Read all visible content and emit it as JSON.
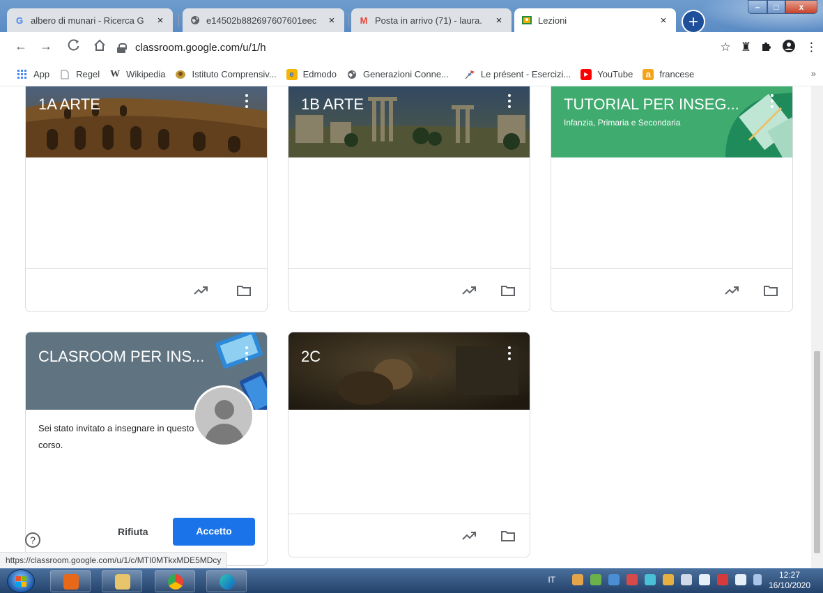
{
  "browser": {
    "tabs": [
      {
        "title": "albero di munari - Ricerca G",
        "icon": "google-g-icon",
        "icon_text": "G",
        "icon_color": "#4285f4"
      },
      {
        "title": "e14502b882697607601eec",
        "icon": "globe-icon",
        "icon_text": "",
        "icon_color": "#5f6368"
      },
      {
        "title": "Posta in arrivo (71) - laura.",
        "icon": "gmail-icon",
        "icon_text": "M",
        "icon_color": "#ea4335"
      },
      {
        "title": "Lezioni",
        "icon": "classroom-icon",
        "icon_text": "",
        "icon_color": "#f9ab00"
      }
    ],
    "new_tab_label": "+",
    "close_label": "×",
    "url": "classroom.google.com/u/1/h",
    "window_controls": {
      "min": "–",
      "max": "□",
      "close": "x"
    }
  },
  "bookmarks": [
    {
      "label": "App",
      "icon": "apps-grid-icon",
      "icon_text": "⁝⁝⁝",
      "color": "#4285f4"
    },
    {
      "label": "Regel",
      "icon": "page-icon",
      "icon_text": "",
      "color": "#9aa0a6"
    },
    {
      "label": "Wikipedia",
      "icon": "wikipedia-icon",
      "icon_text": "W",
      "color": "#000000"
    },
    {
      "label": "Istituto Comprensiv...",
      "icon": "school-crest-icon",
      "icon_text": "",
      "color": "#c49a3a"
    },
    {
      "label": "Edmodo",
      "icon": "edmodo-icon",
      "icon_text": "e",
      "color": "#f4b400"
    },
    {
      "label": "Generazioni Conne...",
      "icon": "globe-icon",
      "icon_text": "",
      "color": "#5f6368"
    },
    {
      "label": "Le présent - Esercizi...",
      "icon": "flag-fr-icon",
      "icon_text": "",
      "color": "#3a6fd8"
    },
    {
      "label": "YouTube",
      "icon": "youtube-icon",
      "icon_text": "▶",
      "color": "#ff0000"
    },
    {
      "label": "francese",
      "icon": "folder-a-icon",
      "icon_text": "a",
      "color": "#f4a31c"
    }
  ],
  "bookmarks_more": "»",
  "colors": {
    "card_green": "#3fab6f",
    "card_slate": "#5f7380",
    "accent_blue": "#1a73e8"
  },
  "cards": [
    {
      "title": "1A ARTE",
      "subtitle": ""
    },
    {
      "title": "1B ARTE",
      "subtitle": ""
    },
    {
      "title": "TUTORIAL PER INSEG...",
      "subtitle": "Infanzia, Primaria e Secondaria"
    },
    {
      "title": "CLASROOM PER INS...",
      "subtitle": "",
      "invite_text": "Sei stato invitato a insegnare in questo corso.",
      "reject_label": "Rifiuta",
      "accept_label": "Accetto"
    },
    {
      "title": "2C",
      "subtitle": ""
    }
  ],
  "help_label": "?",
  "status_url": "https://classroom.google.com/u/1/c/MTI0MTkxMDE5MDcy",
  "taskbar": {
    "language": "IT",
    "time": "12:27",
    "date": "16/10/2020"
  }
}
